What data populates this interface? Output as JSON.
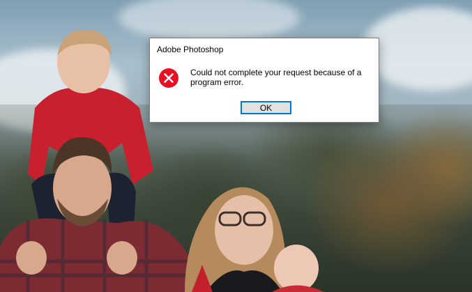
{
  "dialog": {
    "title": "Adobe Photoshop",
    "icon": "error-icon",
    "message": "Could not complete your request because of a program error.",
    "ok_label": "OK",
    "accent_color": "#0078d7",
    "icon_color": "#e81123"
  }
}
